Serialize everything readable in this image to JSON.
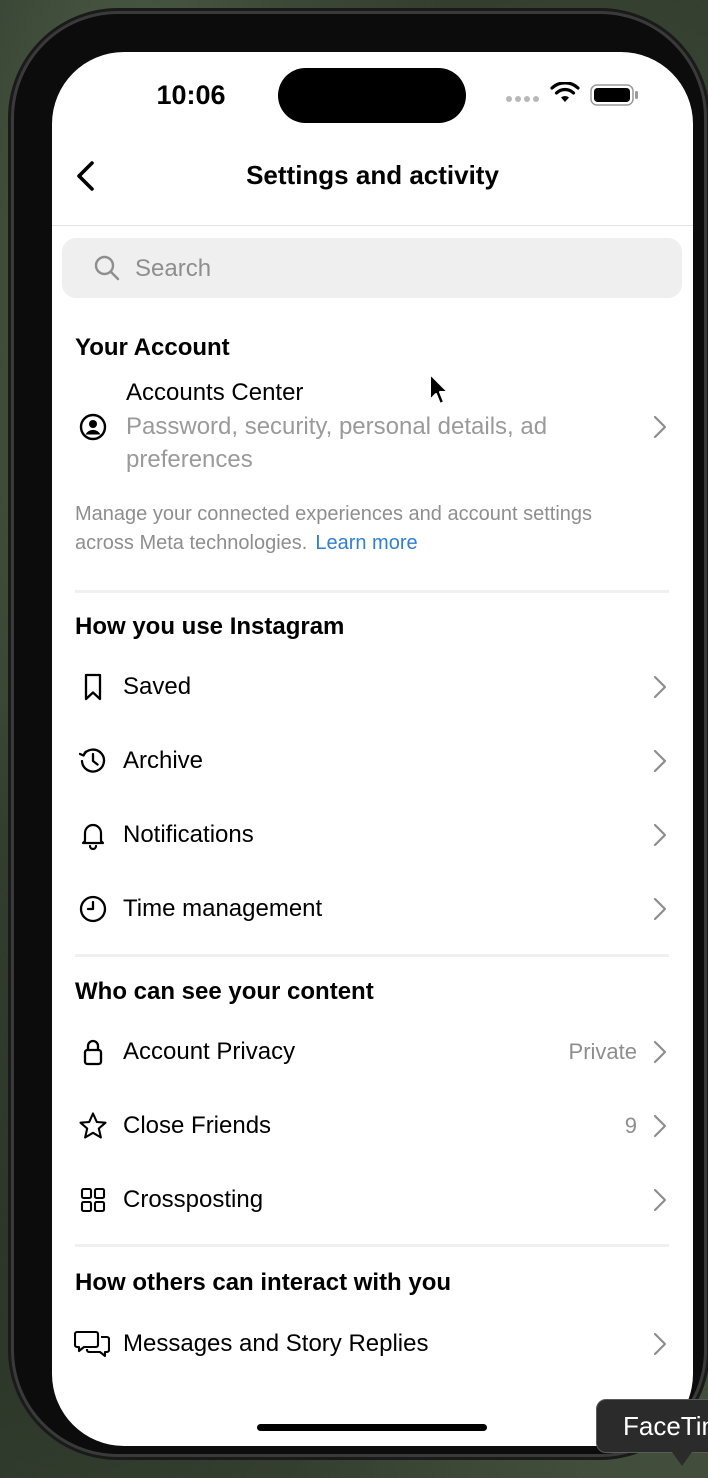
{
  "status_bar": {
    "time": "10:06"
  },
  "nav": {
    "title": "Settings and activity"
  },
  "search": {
    "placeholder": "Search"
  },
  "your_account": {
    "title": "Your Account",
    "accounts_center": {
      "label": "Accounts Center",
      "subtitle": "Password, security, personal details, ad preferences"
    },
    "note": "Manage your connected experiences and account settings across Meta technologies.",
    "learn_more": "Learn more"
  },
  "how_you_use": {
    "title": "How you use Instagram",
    "items": [
      {
        "label": "Saved",
        "icon": "bookmark-icon"
      },
      {
        "label": "Archive",
        "icon": "archive-clock-icon"
      },
      {
        "label": "Notifications",
        "icon": "bell-icon"
      },
      {
        "label": "Time management",
        "icon": "clock-icon"
      }
    ]
  },
  "who_can_see": {
    "title": "Who can see your content",
    "items": [
      {
        "label": "Account Privacy",
        "value": "Private",
        "icon": "lock-icon"
      },
      {
        "label": "Close Friends",
        "value": "9",
        "icon": "star-icon"
      },
      {
        "label": "Crossposting",
        "value": "",
        "icon": "grid-icon"
      }
    ]
  },
  "how_others": {
    "title": "How others can interact with you",
    "items": [
      {
        "label": "Messages and Story Replies",
        "icon": "messages-icon"
      }
    ]
  },
  "tooltip": {
    "text": "FaceTime"
  },
  "colors": {
    "link": "#2f7fd6",
    "secondary_text": "#8e8e8e",
    "search_bg": "#efefef"
  }
}
